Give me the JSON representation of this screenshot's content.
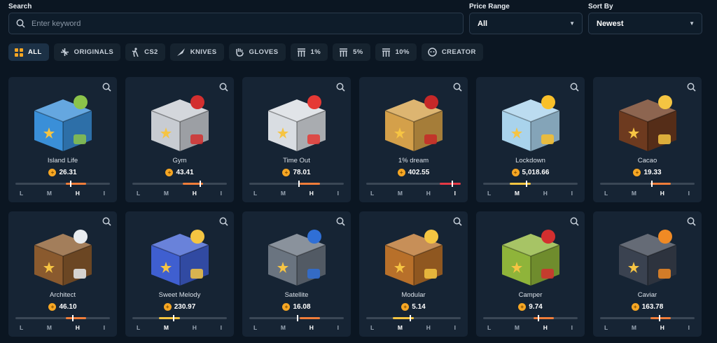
{
  "search": {
    "label": "Search",
    "placeholder": "Enter keyword"
  },
  "price_range": {
    "label": "Price Range",
    "value": "All"
  },
  "sort_by": {
    "label": "Sort By",
    "value": "Newest"
  },
  "filters": [
    {
      "label": "ALL",
      "icon": "grid-icon",
      "active": true
    },
    {
      "label": "ORIGINALS",
      "icon": "plane-icon",
      "active": false
    },
    {
      "label": "CS2",
      "icon": "soldier-icon",
      "active": false
    },
    {
      "label": "KNIVES",
      "icon": "knife-icon",
      "active": false
    },
    {
      "label": "GLOVES",
      "icon": "glove-icon",
      "active": false
    },
    {
      "label": "1%",
      "icon": "podium-icon",
      "active": false
    },
    {
      "label": "5%",
      "icon": "podium-icon",
      "active": false
    },
    {
      "label": "10%",
      "icon": "podium-icon",
      "active": false
    },
    {
      "label": "CREATOR",
      "icon": "creator-icon",
      "active": false
    }
  ],
  "level_labels": [
    "L",
    "M",
    "H",
    "I"
  ],
  "cases": [
    {
      "name": "Island Life",
      "price": "26.31",
      "level": "H",
      "marker": 0.58,
      "box": "#3a8fd8",
      "accent": "#8bc34a"
    },
    {
      "name": "Gym",
      "price": "43.41",
      "level": "H",
      "marker": 0.71,
      "box": "#c8ccd2",
      "accent": "#d32f2f"
    },
    {
      "name": "Time Out",
      "price": "78.01",
      "level": "H",
      "marker": 0.52,
      "box": "#d9dde2",
      "accent": "#e53935"
    },
    {
      "name": "1% dream",
      "price": "402.55",
      "level": "I",
      "marker": 0.9,
      "box": "#d4a04a",
      "accent": "#c62828"
    },
    {
      "name": "Lockdown",
      "price": "5,018.66",
      "level": "M",
      "marker": 0.45,
      "box": "#a9d3ec",
      "accent": "#f9c02a"
    },
    {
      "name": "Cacao",
      "price": "19.33",
      "level": "H",
      "marker": 0.54,
      "box": "#6d3a1f",
      "accent": "#f4c542"
    },
    {
      "name": "Architect",
      "price": "46.10",
      "level": "H",
      "marker": 0.6,
      "box": "#8a5a2e",
      "accent": "#e8ecf0"
    },
    {
      "name": "Sweet Melody",
      "price": "230.97",
      "level": "M",
      "marker": 0.43,
      "box": "#3f5fd0",
      "accent": "#f4c542"
    },
    {
      "name": "Satellite",
      "price": "16.08",
      "level": "H",
      "marker": 0.5,
      "box": "#6a7480",
      "accent": "#2f6fd6"
    },
    {
      "name": "Modular",
      "price": "5.14",
      "level": "M",
      "marker": 0.46,
      "box": "#b8702a",
      "accent": "#f4c542"
    },
    {
      "name": "Camper",
      "price": "9.74",
      "level": "H",
      "marker": 0.58,
      "box": "#8fb43a",
      "accent": "#d32f2f"
    },
    {
      "name": "Caviar",
      "price": "163.78",
      "level": "H",
      "marker": 0.62,
      "box": "#3a4250",
      "accent": "#f08a24"
    }
  ],
  "colors": {
    "M": "#f4c542",
    "H": "#ef7d3a",
    "I": "#e53945",
    "track": "#3a4756"
  }
}
